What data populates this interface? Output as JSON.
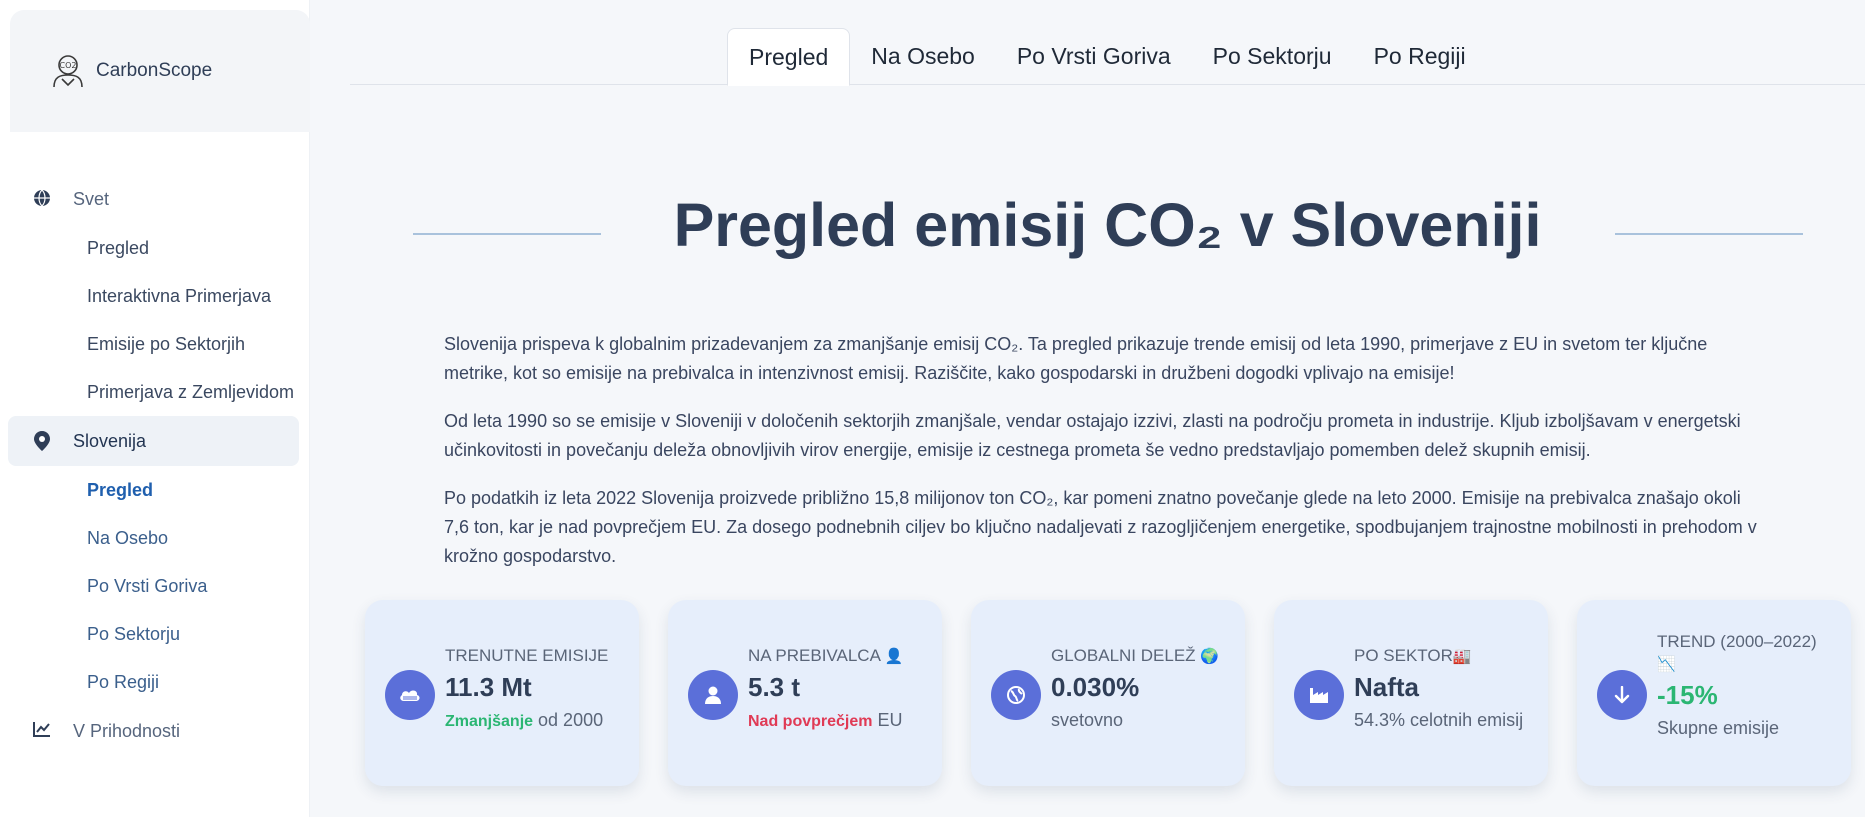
{
  "brand": {
    "name": "CarbonScope"
  },
  "sidebar": {
    "section_world": "Svet",
    "world_items": [
      "Pregled",
      "Interaktivna Primerjava",
      "Emisije po Sektorjih",
      "Primerjava z Zemljevidom"
    ],
    "section_slovenia": "Slovenija",
    "slovenia_items": [
      "Pregled",
      "Na Osebo",
      "Po Vrsti Goriva",
      "Po Sektorju",
      "Po Regiji"
    ],
    "section_future": "V Prihodnosti"
  },
  "tabs": [
    "Pregled",
    "Na Osebo",
    "Po Vrsti Goriva",
    "Po Sektorju",
    "Po Regiji"
  ],
  "active_tab": "Pregled",
  "page_title": "Pregled emisij CO₂ v Sloveniji",
  "paragraphs": [
    "Slovenija prispeva k globalnim prizadevanjem za zmanjšanje emisij CO₂. Ta pregled prikazuje trende emisij od leta 1990, primerjave z EU in svetom ter ključne metrike, kot so emisije na prebivalca in intenzivnost emisij. Raziščite, kako gospodarski in družbeni dogodki vplivajo na emisije!",
    "Od leta 1990 so se emisije v Sloveniji v določenih sektorjih zmanjšale, vendar ostajajo izzivi, zlasti na področju prometa in industrije. Kljub izboljšavam v energetski učinkovitosti in povečanju deleža obnovljivih virov energije, emisije iz cestnega prometa še vedno predstavljajo pomemben delež skupnih emisij.",
    "Po podatkih iz leta 2022 Slovenija proizvede približno 15,8 milijonov ton CO₂, kar pomeni znatno povečanje glede na leto 2000. Emisije na prebivalca znašajo okoli 7,6 ton, kar je nad povprečjem EU. Za dosego podnebnih ciljev bo ključno nadaljevati z razogljičenjem energetike, spodbujanjem trajnostne mobilnosti in prehodom v krožno gospodarstvo."
  ],
  "cards": {
    "current": {
      "label": "TRENUTNE EMISIJE",
      "value": "11.3 Mt",
      "badge": "Zmanjšanje",
      "sub": " od 2000"
    },
    "per_capita": {
      "label": "NA PREBIVALCA",
      "emoji": "👤",
      "value": "5.3 t",
      "badge": "Nad povprečjem",
      "sub": " EU"
    },
    "global": {
      "label": "GLOBALNI DELEŽ",
      "emoji": "🌍",
      "value": "0.030%",
      "sub": "svetovno"
    },
    "sector": {
      "label": "PO SEKTOR",
      "emoji": "🏭",
      "value": "Nafta",
      "sub": "54.3% celotnih emisij"
    },
    "trend": {
      "label": "TREND (2000–2022)",
      "emoji": "📉",
      "value": "-15%",
      "sub": "Skupne emisije"
    }
  },
  "colors": {
    "accent": "#5b6fd9",
    "card_bg": "#e6eefb",
    "green": "#2bb673",
    "red": "#e03a55",
    "title": "#2f3e57"
  },
  "icons": {
    "world": "globe-icon",
    "slovenia": "map-pin-icon",
    "future": "chart-line-icon",
    "current": "cloud-icon",
    "per_capita": "user-icon",
    "global": "globe-icon",
    "sector": "factory-icon",
    "trend": "arrow-down-icon"
  }
}
